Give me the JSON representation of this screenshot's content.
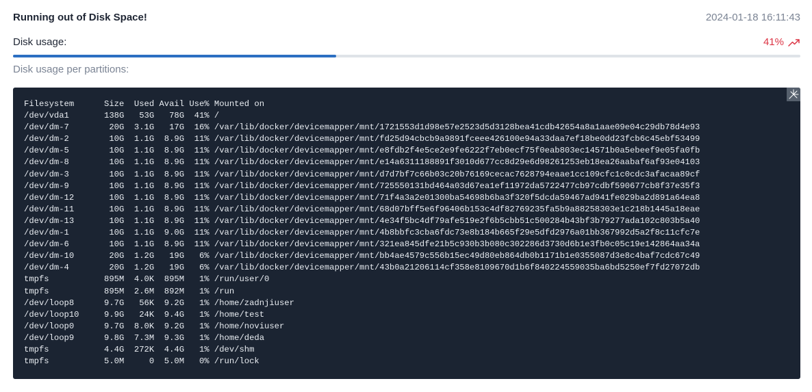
{
  "alert": {
    "title": "Running out of Disk Space!",
    "timestamp": "2024-01-18 16:11:43"
  },
  "usage": {
    "label": "Disk usage:",
    "value": "41%",
    "percent": 41,
    "trend_icon": "trending-up-icon",
    "accent_color": "#dc3545",
    "bar_color": "#2c6fc2"
  },
  "partitions": {
    "label": "Disk usage per partitions:",
    "expand_icon": "expand-icon",
    "output": [
      "Filesystem      Size  Used Avail Use% Mounted on",
      "/dev/vda1       138G   53G   78G  41% /",
      "/dev/dm-7        20G  3.1G   17G  16% /var/lib/docker/devicemapper/mnt/1721553d1d98e57e2523d5d3128bea41cdb42654a8a1aae09e04c29db78d4e93",
      "/dev/dm-2        10G  1.1G  8.9G  11% /var/lib/docker/devicemapper/mnt/fd25d94cbcb9a9891fceee426100e94a33daa7ef18be0dd23fcb6c45ebf53499",
      "/dev/dm-5        10G  1.1G  8.9G  11% /var/lib/docker/devicemapper/mnt/e8fdb2f4e5ce2e9fe6222f7eb0ecf75f0eab803ec14571b0a5ebeef9e05fa0fb",
      "/dev/dm-8        10G  1.1G  8.9G  11% /var/lib/docker/devicemapper/mnt/e14a6311188891f3010d677cc8d29e6d98261253eb18ea26aabaf6af93e04103",
      "/dev/dm-3        10G  1.1G  8.9G  11% /var/lib/docker/devicemapper/mnt/d7d7bf7c66b03c20b76169cecac7628794eaae1cc109cfc1c0cdc3afacaa89cf",
      "/dev/dm-9        10G  1.1G  8.9G  11% /var/lib/docker/devicemapper/mnt/725550131bd464a03d67ea1ef11972da5722477cb97cdbf590677cb8f37e35f3",
      "/dev/dm-12       10G  1.1G  8.9G  11% /var/lib/docker/devicemapper/mnt/71f4a3a2e01300ba54698b6ba3f320f5dcda59467ad941fe029ba2d891a64ea8",
      "/dev/dm-11       10G  1.1G  8.9G  11% /var/lib/docker/devicemapper/mnt/68d07bff5e6f96406b153c4df82769235fa5b9a88258303e1c218b1445a18eae",
      "/dev/dm-13       10G  1.1G  8.9G  11% /var/lib/docker/devicemapper/mnt/4e34f5bc4df79afe519e2f6b5cbb51c500284b43bf3b79277ada102c803b5a40",
      "/dev/dm-1        10G  1.1G  9.0G  11% /var/lib/docker/devicemapper/mnt/4b8bbfc3cba6fdc73e8b184b665f29e5dfd2976a01bb367992d5a2f8c11cfc7e",
      "/dev/dm-6        10G  1.1G  8.9G  11% /var/lib/docker/devicemapper/mnt/321ea845dfe21b5c930b3b080c302286d3730d6b1e3fb0c05c19e142864aa34a",
      "/dev/dm-10       20G  1.2G   19G   6% /var/lib/docker/devicemapper/mnt/bb4ae4579c556b15ec49d80eb864db0b1171b1e0355087d3e8c4baf7cdc67c49",
      "/dev/dm-4        20G  1.2G   19G   6% /var/lib/docker/devicemapper/mnt/43b0a21206114cf358e8109670d1b6f840224559035ba6bd5250ef7fd27072db",
      "tmpfs           895M  4.0K  895M   1% /run/user/0",
      "tmpfs           895M  2.6M  892M   1% /run",
      "/dev/loop8      9.7G   56K  9.2G   1% /home/zadnjiuser",
      "/dev/loop10     9.9G   24K  9.4G   1% /home/test",
      "/dev/loop0      9.7G  8.0K  9.2G   1% /home/noviuser",
      "/dev/loop9      9.8G  7.3M  9.3G   1% /home/deda",
      "tmpfs           4.4G  272K  4.4G   1% /dev/shm",
      "tmpfs           5.0M     0  5.0M   0% /run/lock"
    ]
  }
}
